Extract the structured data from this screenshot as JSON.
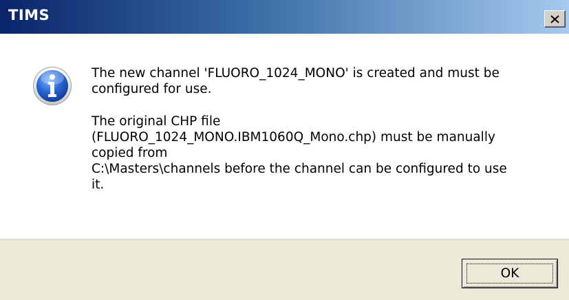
{
  "window": {
    "title": "TIMS",
    "close_icon": "close-icon"
  },
  "content": {
    "icon": "info-icon",
    "paragraph1": {
      "lines": [
        "The new channel 'FLUORO_1024_MONO' is created and must be",
        "configured for use."
      ]
    },
    "paragraph2": {
      "lines": [
        "The original CHP file",
        "(FLUORO_1024_MONO.IBM1060Q_Mono.chp) must be manually",
        "copied from",
        "C:\\Masters\\channels before the channel can be configured to use",
        "it."
      ]
    }
  },
  "buttons": {
    "ok_label": "OK"
  },
  "colors": {
    "title_gradient_start": "#0a246a",
    "title_gradient_end": "#a6caf0",
    "content_bg": "#ffffff",
    "footer_bg": "#ece9d8",
    "info_icon_blue": "#1e5cc8"
  }
}
